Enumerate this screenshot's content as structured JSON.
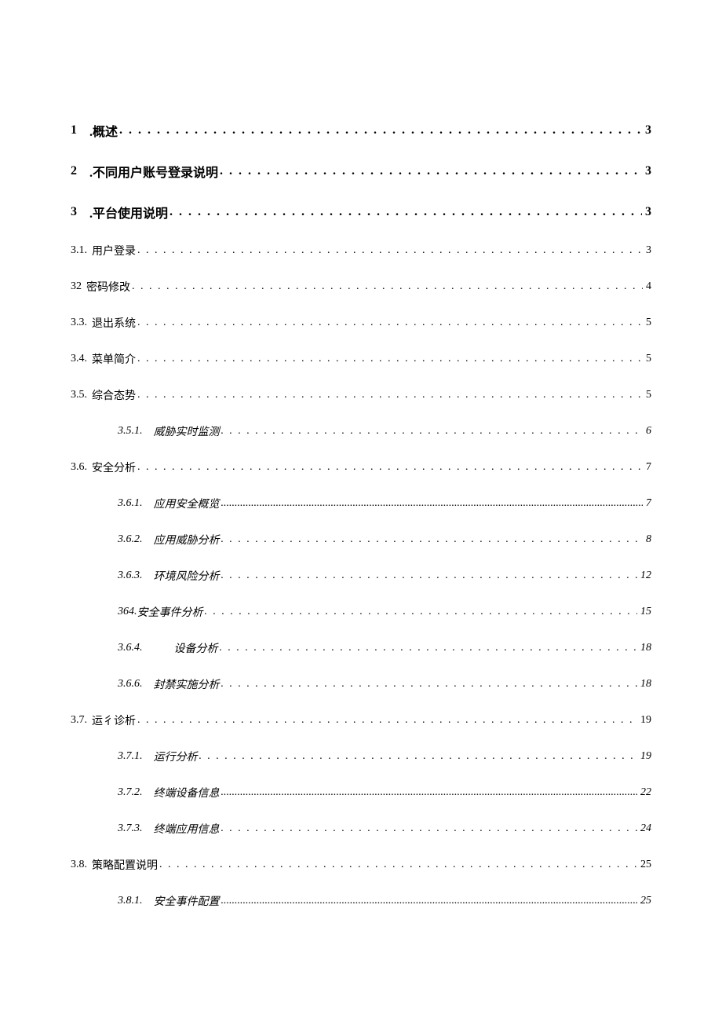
{
  "toc": [
    {
      "level": 1,
      "num": "1",
      "title": ".概述",
      "page": "3",
      "leader": "loose"
    },
    {
      "level": 1,
      "num": "2",
      "title": ".不同用户账号登录说明",
      "page": "3",
      "leader": "loose"
    },
    {
      "level": 1,
      "num": "3",
      "title": ".平台使用说明",
      "page": "3",
      "leader": "loose"
    },
    {
      "level": 2,
      "num": "3.1.",
      "title": "用户登录",
      "page": "3",
      "leader": "loose"
    },
    {
      "level": 2,
      "num": "32",
      "title": "密码修改",
      "page": "4",
      "leader": "loose"
    },
    {
      "level": 2,
      "num": "3.3.",
      "title": "退出系统",
      "page": "5",
      "leader": "loose"
    },
    {
      "level": 2,
      "num": "3.4.",
      "title": "菜单简介",
      "page": "5",
      "leader": "loose"
    },
    {
      "level": 2,
      "num": "3.5.",
      "title": "综合态势",
      "page": "5",
      "leader": "loose"
    },
    {
      "level": 3,
      "num": "3.5.1.",
      "title": "威胁实时监测",
      "page": "6",
      "leader": "loose"
    },
    {
      "level": 2,
      "num": "3.6.",
      "title": "安全分析",
      "page": "7",
      "leader": "loose"
    },
    {
      "level": 3,
      "num": "3.6.1.",
      "title": "应用安全概览",
      "page": "7",
      "leader": "tight"
    },
    {
      "level": 3,
      "num": "3.6.2.",
      "title": "应用威胁分析",
      "page": "8",
      "leader": "loose"
    },
    {
      "level": 3,
      "num": "3.6.3.",
      "title": "环境风险分析",
      "page": "12",
      "leader": "loose"
    },
    {
      "level": 3,
      "num": "364.",
      "title": "安全事件分析",
      "page": "15",
      "leader": "loose",
      "no_num_space": true
    },
    {
      "level": 3,
      "num": "3.6.4.",
      "title": "设备分析",
      "page": "18",
      "leader": "loose",
      "wide_gap": true
    },
    {
      "level": 3,
      "num": "3.6.6.",
      "title": "封禁实施分析",
      "page": "18",
      "leader": "loose"
    },
    {
      "level": 2,
      "num": "3.7.",
      "title": "运彳诊析",
      "page": "19",
      "leader": "loose"
    },
    {
      "level": 3,
      "num": "3.7.1.",
      "title": "运行分析",
      "page": "19",
      "leader": "loose"
    },
    {
      "level": 3,
      "num": "3.7.2.",
      "title": "终端设备信息",
      "page": "22",
      "leader": "tight"
    },
    {
      "level": 3,
      "num": "3.7.3.",
      "title": "终端应用信息",
      "page": "24",
      "leader": "loose"
    },
    {
      "level": 2,
      "num": "3.8.",
      "title": "策略配置说明",
      "page": "25",
      "leader": "loose"
    },
    {
      "level": 3,
      "num": "3.8.1.",
      "title": "安全事件配置",
      "page": "25",
      "leader": "tight"
    }
  ]
}
